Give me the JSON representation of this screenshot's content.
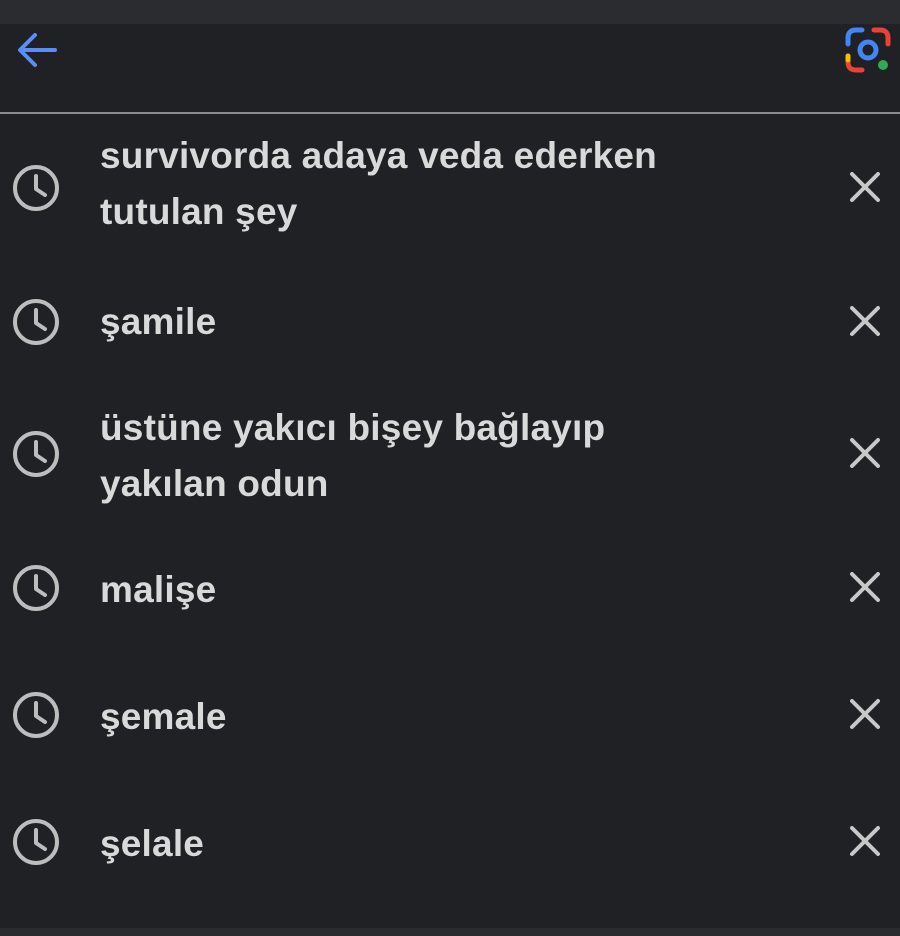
{
  "header": {
    "back_icon": "arrow-left-icon",
    "lens_icon": "google-lens-icon",
    "accent_color": "#5a8ef6"
  },
  "history": [
    {
      "line1": "survivorda adaya veda ederken",
      "line2": "tutulan şey",
      "icon": "clock-icon",
      "remove_icon": "close-icon"
    },
    {
      "line1": "şamile",
      "line2": "",
      "icon": "clock-icon",
      "remove_icon": "close-icon"
    },
    {
      "line1": "üstüne yakıcı bişey bağlayıp",
      "line2": "yakılan odun",
      "icon": "clock-icon",
      "remove_icon": "close-icon"
    },
    {
      "line1": "malişe",
      "line2": "",
      "icon": "clock-icon",
      "remove_icon": "close-icon"
    },
    {
      "line1": "şemale",
      "line2": "",
      "icon": "clock-icon",
      "remove_icon": "close-icon"
    },
    {
      "line1": "şelale",
      "line2": "",
      "icon": "clock-icon",
      "remove_icon": "close-icon"
    }
  ]
}
